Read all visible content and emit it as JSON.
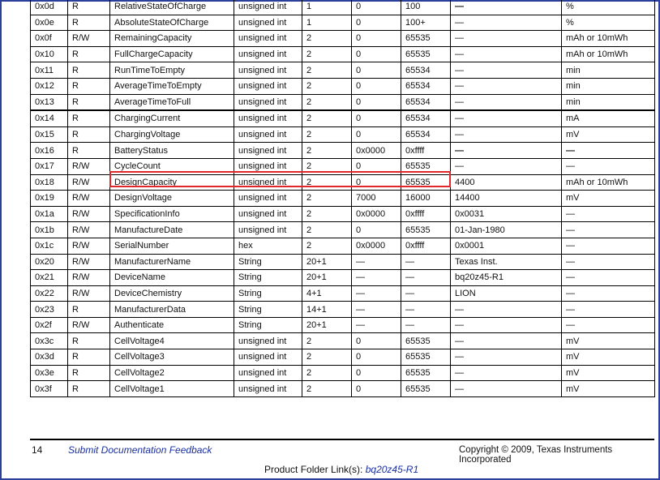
{
  "table": {
    "rows": [
      {
        "addr": "0x0d",
        "access": "R",
        "name": "RelativeStateOfCharge",
        "format": "unsigned int",
        "size": "1",
        "min": "0",
        "max": "100",
        "default": "—",
        "unit": "%"
      },
      {
        "addr": "0x0e",
        "access": "R",
        "name": "AbsoluteStateOfCharge",
        "format": "unsigned int",
        "size": "1",
        "min": "0",
        "max": "100+",
        "default": "—",
        "unit": "%"
      },
      {
        "addr": "0x0f",
        "access": "R/W",
        "name": "RemainingCapacity",
        "format": "unsigned int",
        "size": "2",
        "min": "0",
        "max": "65535",
        "default": "—",
        "unit": "mAh or 10mWh"
      },
      {
        "addr": "0x10",
        "access": "R",
        "name": "FullChargeCapacity",
        "format": "unsigned int",
        "size": "2",
        "min": "0",
        "max": "65535",
        "default": "—",
        "unit": "mAh or 10mWh"
      },
      {
        "addr": "0x11",
        "access": "R",
        "name": "RunTimeToEmpty",
        "format": "unsigned int",
        "size": "2",
        "min": "0",
        "max": "65534",
        "default": "—",
        "unit": "min"
      },
      {
        "addr": "0x12",
        "access": "R",
        "name": "AverageTimeToEmpty",
        "format": "unsigned int",
        "size": "2",
        "min": "0",
        "max": "65534",
        "default": "—",
        "unit": "min"
      },
      {
        "addr": "0x13",
        "access": "R",
        "name": "AverageTimeToFull",
        "format": "unsigned int",
        "size": "2",
        "min": "0",
        "max": "65534",
        "default": "—",
        "unit": "min"
      },
      {
        "addr": "0x14",
        "access": "R",
        "name": "ChargingCurrent",
        "format": "unsigned int",
        "size": "2",
        "min": "0",
        "max": "65534",
        "default": "—",
        "unit": "mA"
      },
      {
        "addr": "0x15",
        "access": "R",
        "name": "ChargingVoltage",
        "format": "unsigned int",
        "size": "2",
        "min": "0",
        "max": "65534",
        "default": "—",
        "unit": "mV"
      },
      {
        "addr": "0x16",
        "access": "R",
        "name": "BatteryStatus",
        "format": "unsigned int",
        "size": "2",
        "min": "0x0000",
        "max": "0xffff",
        "default": "—",
        "unit": "—"
      },
      {
        "addr": "0x17",
        "access": "R/W",
        "name": "CycleCount",
        "format": "unsigned int",
        "size": "2",
        "min": "0",
        "max": "65535",
        "default": "—",
        "unit": "—"
      },
      {
        "addr": "0x18",
        "access": "R/W",
        "name": "DesignCapacity",
        "format": "unsigned int",
        "size": "2",
        "min": "0",
        "max": "65535",
        "default": "4400",
        "unit": "mAh or 10mWh"
      },
      {
        "addr": "0x19",
        "access": "R/W",
        "name": "DesignVoltage",
        "format": "unsigned int",
        "size": "2",
        "min": "7000",
        "max": "16000",
        "default": "14400",
        "unit": "mV"
      },
      {
        "addr": "0x1a",
        "access": "R/W",
        "name": "SpecificationInfo",
        "format": "unsigned int",
        "size": "2",
        "min": "0x0000",
        "max": "0xffff",
        "default": "0x0031",
        "unit": "—"
      },
      {
        "addr": "0x1b",
        "access": "R/W",
        "name": "ManufactureDate",
        "format": "unsigned int",
        "size": "2",
        "min": "0",
        "max": "65535",
        "default": "01-Jan-1980",
        "unit": "—"
      },
      {
        "addr": "0x1c",
        "access": "R/W",
        "name": "SerialNumber",
        "format": "hex",
        "size": "2",
        "min": "0x0000",
        "max": "0xffff",
        "default": "0x0001",
        "unit": "—"
      },
      {
        "addr": "0x20",
        "access": "R/W",
        "name": "ManufacturerName",
        "format": "String",
        "size": "20+1",
        "min": "—",
        "max": "—",
        "default": "Texas Inst.",
        "unit": "—"
      },
      {
        "addr": "0x21",
        "access": "R/W",
        "name": "DeviceName",
        "format": "String",
        "size": "20+1",
        "min": "—",
        "max": "—",
        "default": "bq20z45-R1",
        "unit": "—"
      },
      {
        "addr": "0x22",
        "access": "R/W",
        "name": "DeviceChemistry",
        "format": "String",
        "size": "4+1",
        "min": "—",
        "max": "—",
        "default": "LION",
        "unit": "—"
      },
      {
        "addr": "0x23",
        "access": "R",
        "name": "ManufacturerData",
        "format": "String",
        "size": "14+1",
        "min": "—",
        "max": "—",
        "default": "—",
        "unit": "—"
      },
      {
        "addr": "0x2f",
        "access": "R/W",
        "name": "Authenticate",
        "format": "String",
        "size": "20+1",
        "min": "—",
        "max": "—",
        "default": "—",
        "unit": "—"
      },
      {
        "addr": "0x3c",
        "access": "R",
        "name": "CellVoltage4",
        "format": "unsigned int",
        "size": "2",
        "min": "0",
        "max": "65535",
        "default": "—",
        "unit": "mV"
      },
      {
        "addr": "0x3d",
        "access": "R",
        "name": "CellVoltage3",
        "format": "unsigned int",
        "size": "2",
        "min": "0",
        "max": "65535",
        "default": "—",
        "unit": "mV"
      },
      {
        "addr": "0x3e",
        "access": "R",
        "name": "CellVoltage2",
        "format": "unsigned int",
        "size": "2",
        "min": "0",
        "max": "65535",
        "default": "—",
        "unit": "mV"
      },
      {
        "addr": "0x3f",
        "access": "R",
        "name": "CellVoltage1",
        "format": "unsigned int",
        "size": "2",
        "min": "0",
        "max": "65535",
        "default": "—",
        "unit": "mV"
      }
    ]
  },
  "footer": {
    "page_number": "14",
    "feedback_link": "Submit Documentation Feedback",
    "copyright": "Copyright © 2009, Texas Instruments Incorporated",
    "product_folder_label": "Product Folder Link(s):",
    "product_folder_link": "bq20z45-R1"
  },
  "colors": {
    "highlight_border": "#e0282c",
    "link": "#1a2fa0",
    "frame": "#2a3f9a"
  }
}
